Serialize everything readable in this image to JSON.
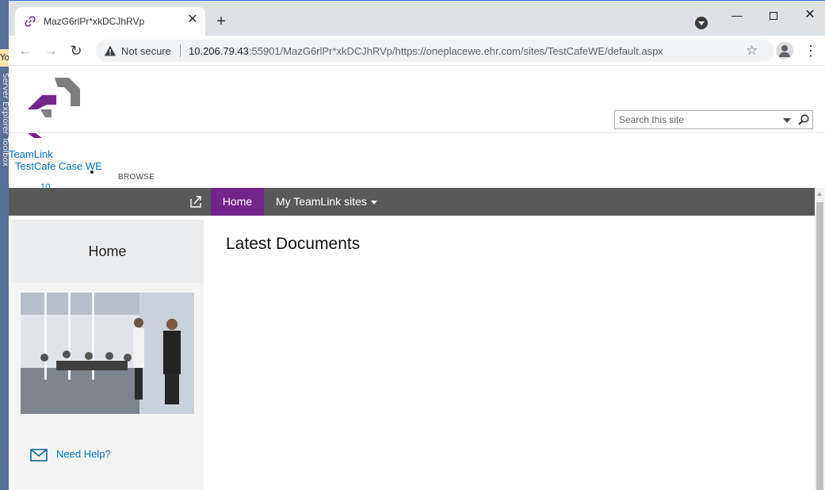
{
  "ide": {
    "side_text": "Yo",
    "vertical_text": "Server Explorer  Toolbox"
  },
  "browser": {
    "tab_title": "MazG6rlPr*xkDCJhRVp",
    "tab_close": "✕",
    "new_tab": "+",
    "window_controls": {
      "minimize": "—",
      "close": "✕"
    },
    "nav": {
      "back": "←",
      "forward": "→",
      "reload": "↻"
    },
    "security_label": "Not secure",
    "url_host": "10.206.79.43",
    "url_rest": ":55901/MazG6rlPr*xkDCJhRVp/https://oneplacewe.ehr.com/sites/TestCafeWE/default.aspx",
    "bookmark_star": "☆",
    "menu": "⋮",
    "icons": [
      "link-icon",
      "warning-icon",
      "star-icon",
      "account-icon",
      "kebab-menu-icon"
    ]
  },
  "site": {
    "search_placeholder": "Search this site",
    "title": "TeamLink",
    "subtitle": "TestCafe Case WE",
    "browse": "BROWSE",
    "partial_link": "10",
    "nav": {
      "home": "Home",
      "my_sites": "My TeamLink sites"
    },
    "accent_color": "#73258b",
    "navbar_color": "#595959",
    "link_color": "#0072c6"
  },
  "leftnav": {
    "home": "Home",
    "help": "Need Help?"
  },
  "main": {
    "title": "Latest Documents"
  }
}
